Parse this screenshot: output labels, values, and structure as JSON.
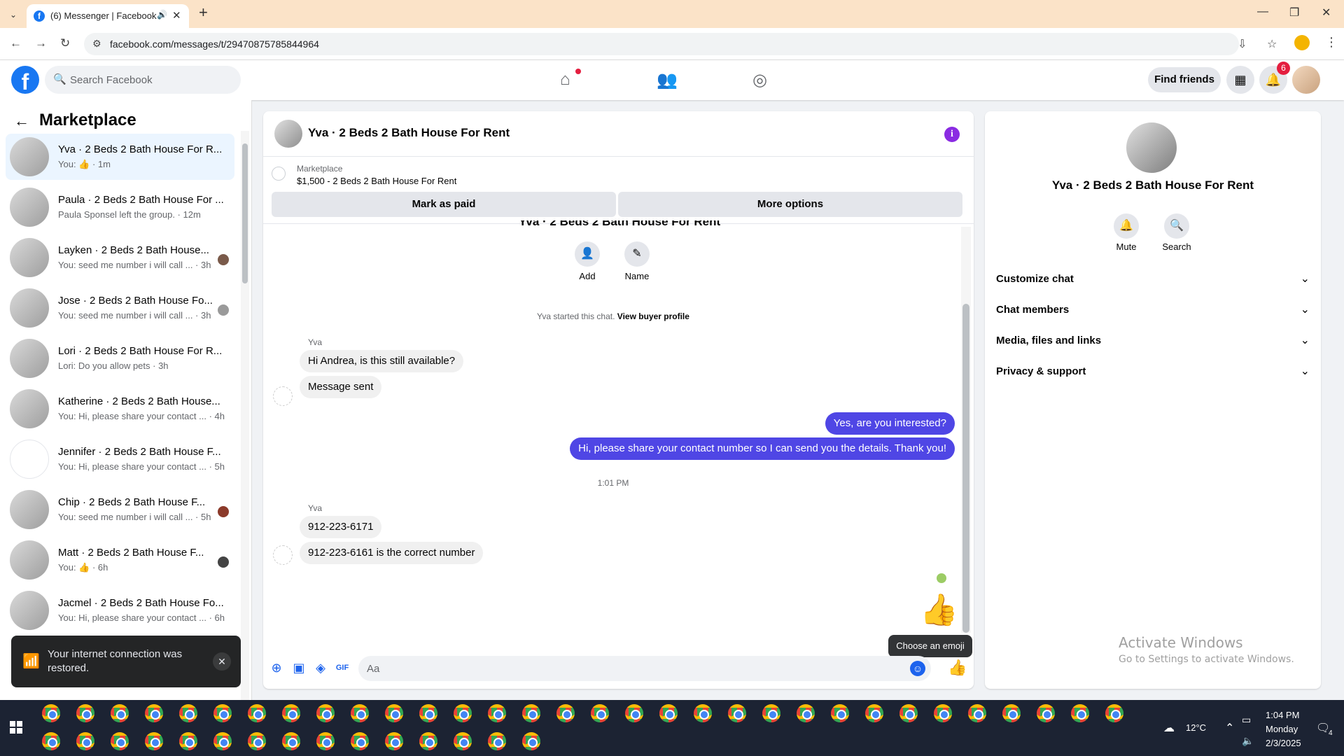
{
  "browser": {
    "tab_title": "(6) Messenger | Facebook",
    "url": "facebook.com/messages/t/29470875785844964"
  },
  "fbnav": {
    "search_placeholder": "Search Facebook",
    "find_friends": "Find friends",
    "notif_count": "6"
  },
  "sidebar": {
    "title": "Marketplace",
    "conversations": [
      {
        "name": "Yva · 2 Beds 2 Bath House For R...",
        "sub": "You: 👍 · 1m"
      },
      {
        "name": "Paula · 2 Beds 2 Bath House For ...",
        "sub": "Paula Sponsel left the group. · 12m"
      },
      {
        "name": "Layken · 2 Beds 2 Bath House...",
        "sub": "You: seed me number i will call ... · 3h"
      },
      {
        "name": "Jose · 2 Beds 2 Bath House Fo...",
        "sub": "You: seed me number i will call ... · 3h"
      },
      {
        "name": "Lori · 2 Beds 2 Bath House For R...",
        "sub": "Lori: Do you allow pets · 3h"
      },
      {
        "name": "Katherine · 2 Beds 2 Bath House...",
        "sub": "You: Hi, please share your contact ... · 4h"
      },
      {
        "name": "Jennifer · 2 Beds 2 Bath House F...",
        "sub": "You: Hi, please share your contact ... · 5h"
      },
      {
        "name": "Chip · 2 Beds 2 Bath House F...",
        "sub": "You: seed me number i will call ... · 5h"
      },
      {
        "name": "Matt · 2 Beds 2 Bath House F...",
        "sub": "You: 👍 · 6h"
      },
      {
        "name": "Jacmel · 2 Beds 2 Bath House Fo...",
        "sub": "You: Hi, please share your contact ... · 6h"
      }
    ],
    "toast": "Your internet connection was restored."
  },
  "chat": {
    "title": "Yva · 2 Beds 2 Bath House For Rent",
    "marketplace_label": "Marketplace",
    "listing": "$1,500 - 2 Beds 2 Bath House For Rent",
    "mark_paid": "Mark as paid",
    "more_options": "More options",
    "cut_title": "Yva · 2 Beds 2 Bath House For Rent",
    "add_label": "Add",
    "name_label": "Name",
    "started": "Yva started this chat.",
    "view_profile": "View buyer profile",
    "sender1": "Yva",
    "msg_in_1": "Hi Andrea, is this still available?",
    "msg_in_2": "Message sent",
    "msg_out_1": "Yes, are you interested?",
    "msg_out_2": "Hi, please share your contact number so I can send you the details. Thank you!",
    "time": "1:01 PM",
    "sender2": "Yva",
    "msg_in_3": "912-223-6171",
    "msg_in_4": "912-223-6161 is the correct number",
    "tooltip": "Choose an emoji",
    "composer_placeholder": "Aa"
  },
  "info": {
    "name": "Yva · 2 Beds 2 Bath House For Rent",
    "mute": "Mute",
    "search": "Search",
    "rows": [
      "Customize chat",
      "Chat members",
      "Media, files and links",
      "Privacy & support"
    ],
    "activate_1": "Activate Windows",
    "activate_2": "Go to Settings to activate Windows."
  },
  "taskbar": {
    "temp": "12°C",
    "time": "1:04 PM",
    "day": "Monday",
    "date": "2/3/2025",
    "notif": "4"
  },
  "colors": {
    "fb_blue": "#1877f2",
    "bubble_out": "#4f46e5",
    "badge_red": "#e41e3f"
  }
}
